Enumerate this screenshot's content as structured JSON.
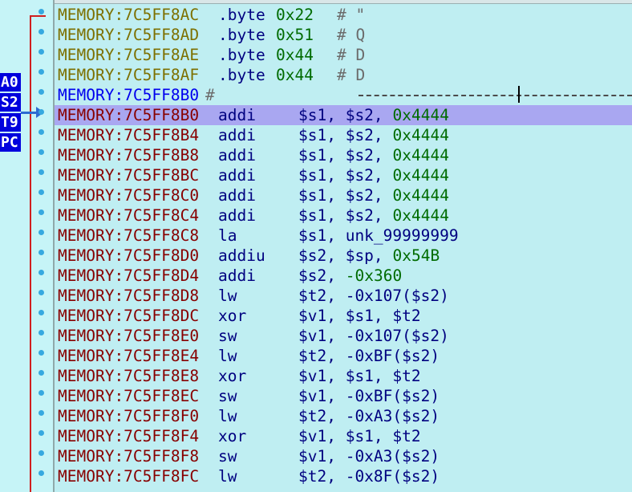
{
  "registers": [
    "A0",
    "S2",
    "T9",
    "PC"
  ],
  "lines": [
    {
      "addr": "MEMORY:7C5FF8AC",
      "kind": "data",
      "mnem": ".byte",
      "op1": "0x22",
      "comment": "# \""
    },
    {
      "addr": "MEMORY:7C5FF8AD",
      "kind": "data",
      "mnem": ".byte",
      "op1": "0x51",
      "comment": "# Q"
    },
    {
      "addr": "MEMORY:7C5FF8AE",
      "kind": "data",
      "mnem": ".byte",
      "op1": "0x44",
      "comment": "# D"
    },
    {
      "addr": "MEMORY:7C5FF8AF",
      "kind": "data",
      "mnem": ".byte",
      "op1": "0x44",
      "comment": "# D"
    },
    {
      "addr": "MEMORY:7C5FF8B0",
      "kind": "separator",
      "mnem": "#",
      "op1": "",
      "comment": ""
    },
    {
      "addr": "MEMORY:7C5FF8B0",
      "kind": "code",
      "highlight": true,
      "mnem": "addi",
      "op1": "$s1, $s2,",
      "op2": "0x4444"
    },
    {
      "addr": "MEMORY:7C5FF8B4",
      "kind": "code",
      "mnem": "addi",
      "op1": "$s1, $s2,",
      "op2": "0x4444"
    },
    {
      "addr": "MEMORY:7C5FF8B8",
      "kind": "code",
      "mnem": "addi",
      "op1": "$s1, $s2,",
      "op2": "0x4444"
    },
    {
      "addr": "MEMORY:7C5FF8BC",
      "kind": "code",
      "mnem": "addi",
      "op1": "$s1, $s2,",
      "op2": "0x4444"
    },
    {
      "addr": "MEMORY:7C5FF8C0",
      "kind": "code",
      "mnem": "addi",
      "op1": "$s1, $s2,",
      "op2": "0x4444"
    },
    {
      "addr": "MEMORY:7C5FF8C4",
      "kind": "code",
      "mnem": "addi",
      "op1": "$s1, $s2,",
      "op2": "0x4444"
    },
    {
      "addr": "MEMORY:7C5FF8C8",
      "kind": "code",
      "mnem": "la",
      "op1": "$s1, unk_99999999",
      "op2": ""
    },
    {
      "addr": "MEMORY:7C5FF8D0",
      "kind": "code",
      "mnem": "addiu",
      "op1": "$s2, $sp,",
      "op2": "0x54B"
    },
    {
      "addr": "MEMORY:7C5FF8D4",
      "kind": "code",
      "mnem": "addi",
      "op1": "$s2,",
      "op2": "-0x360"
    },
    {
      "addr": "MEMORY:7C5FF8D8",
      "kind": "code",
      "mnem": "lw",
      "op1": "$t2, -0x107($s2)",
      "op2": ""
    },
    {
      "addr": "MEMORY:7C5FF8DC",
      "kind": "code",
      "mnem": "xor",
      "op1": "$v1, $s1, $t2",
      "op2": ""
    },
    {
      "addr": "MEMORY:7C5FF8E0",
      "kind": "code",
      "mnem": "sw",
      "op1": "$v1, -0x107($s2)",
      "op2": ""
    },
    {
      "addr": "MEMORY:7C5FF8E4",
      "kind": "code",
      "mnem": "lw",
      "op1": "$t2, -0xBF($s2)",
      "op2": ""
    },
    {
      "addr": "MEMORY:7C5FF8E8",
      "kind": "code",
      "mnem": "xor",
      "op1": "$v1, $s1, $t2",
      "op2": ""
    },
    {
      "addr": "MEMORY:7C5FF8EC",
      "kind": "code",
      "mnem": "sw",
      "op1": "$v1, -0xBF($s2)",
      "op2": ""
    },
    {
      "addr": "MEMORY:7C5FF8F0",
      "kind": "code",
      "mnem": "lw",
      "op1": "$t2, -0xA3($s2)",
      "op2": ""
    },
    {
      "addr": "MEMORY:7C5FF8F4",
      "kind": "code",
      "mnem": "xor",
      "op1": "$v1, $s1, $t2",
      "op2": ""
    },
    {
      "addr": "MEMORY:7C5FF8F8",
      "kind": "code",
      "mnem": "sw",
      "op1": "$v1, -0xA3($s2)",
      "op2": ""
    },
    {
      "addr": "MEMORY:7C5FF8FC",
      "kind": "code",
      "mnem": "lw",
      "op1": "$t2, -0x8F($s2)",
      "op2": ""
    }
  ]
}
